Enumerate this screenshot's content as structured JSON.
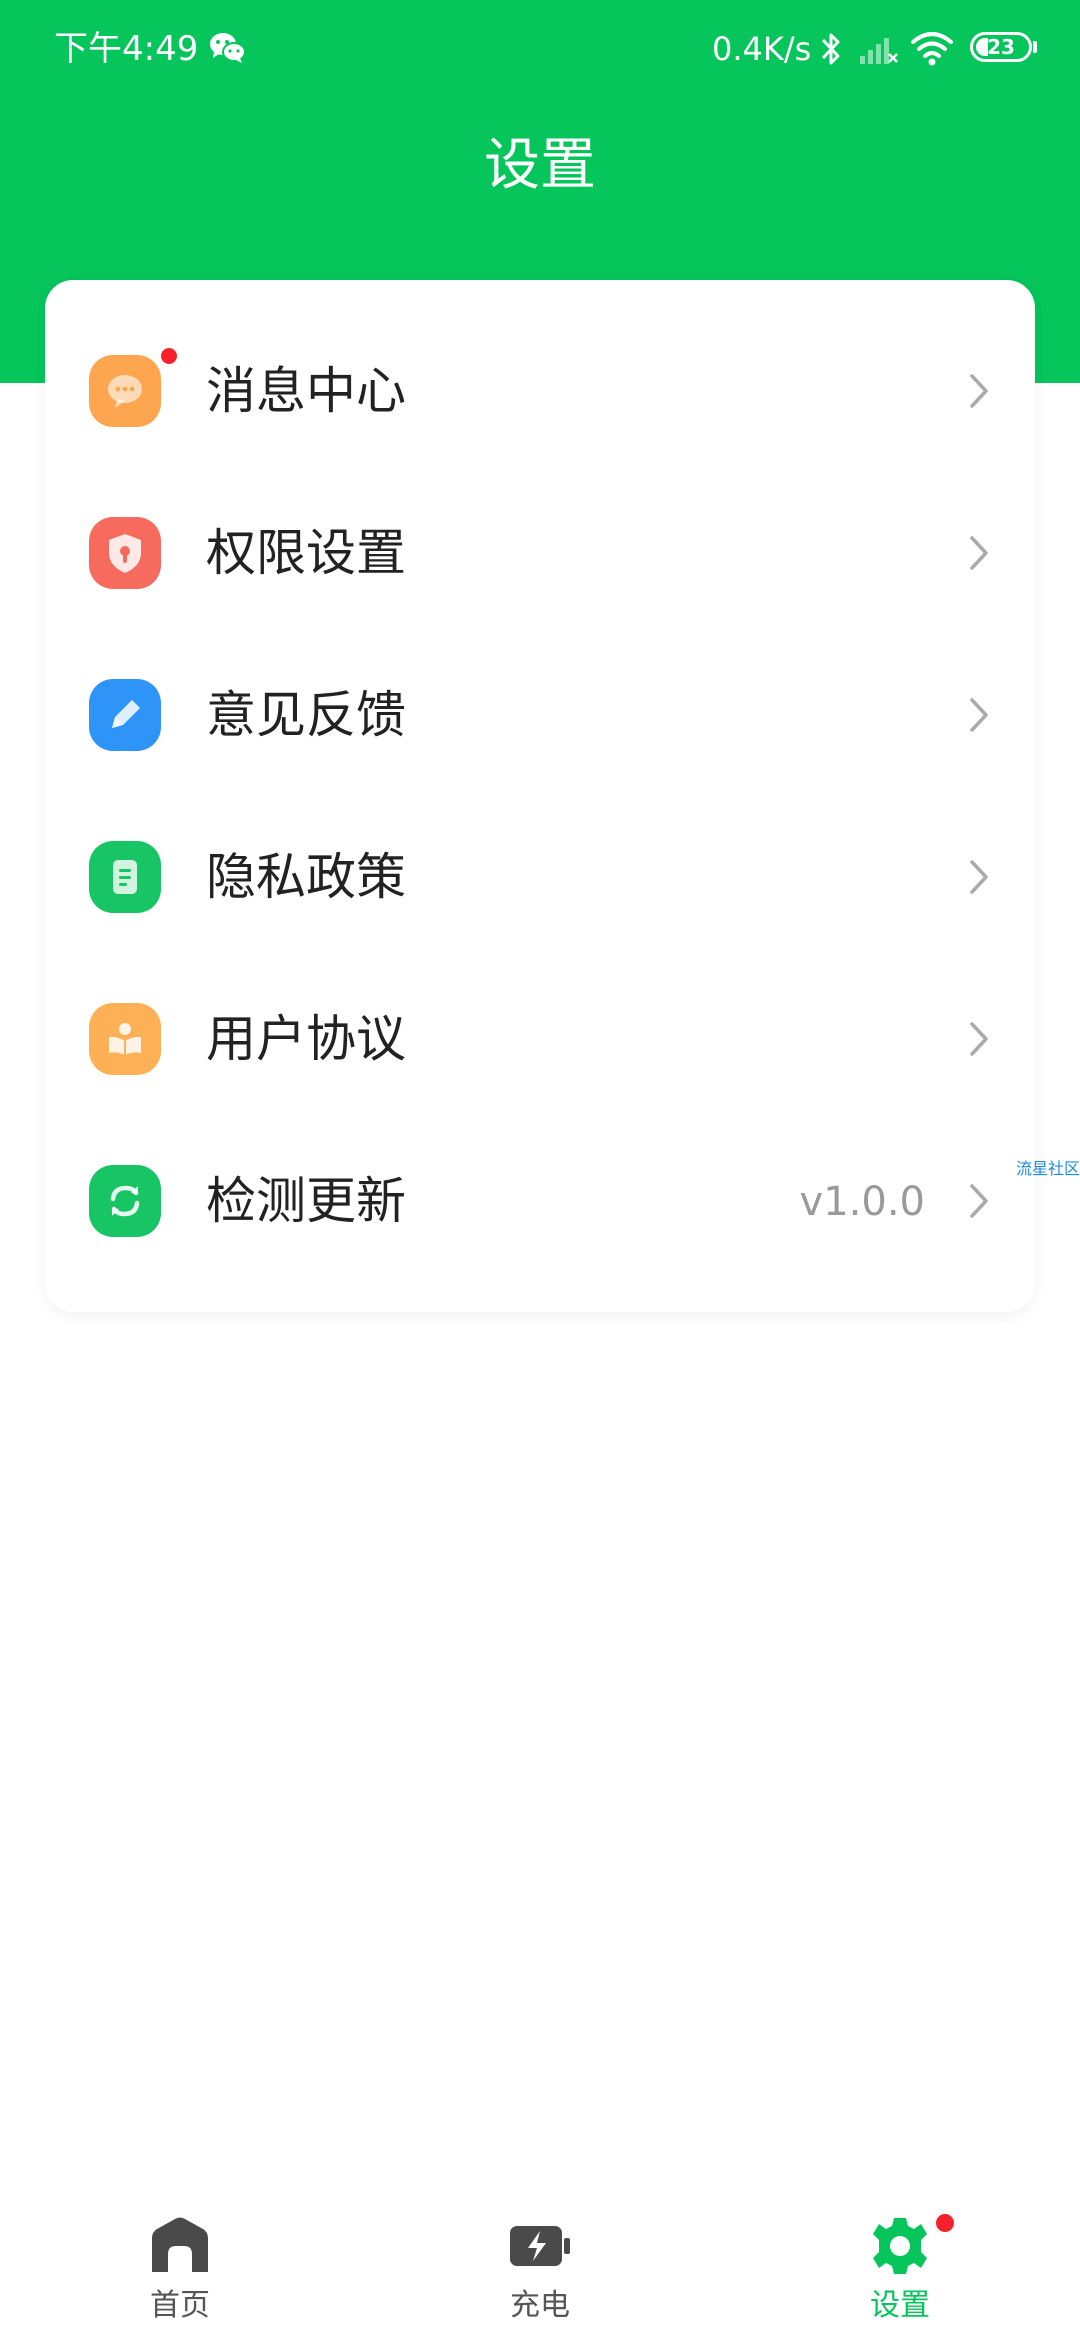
{
  "colors": {
    "brand": "#05c55b",
    "badge": "#f5222d",
    "text": "#222222",
    "muted": "#9a9a9a"
  },
  "status_bar": {
    "time": "下午4:49",
    "net_speed": "0.4K/s",
    "battery": "23",
    "battery_level_percent": 23,
    "icons": [
      "wechat-icon",
      "bluetooth-icon",
      "signal-icon",
      "wifi-icon",
      "battery-icon"
    ]
  },
  "header": {
    "title": "设置"
  },
  "settings": {
    "items": [
      {
        "label": "消息中心",
        "icon": "message-icon",
        "icon_color": "#fda54f",
        "badge": true
      },
      {
        "label": "权限设置",
        "icon": "shield-icon",
        "icon_color": "#f76a5e"
      },
      {
        "label": "意见反馈",
        "icon": "pencil-icon",
        "icon_color": "#2f94f7"
      },
      {
        "label": "隐私政策",
        "icon": "document-icon",
        "icon_color": "#18c564"
      },
      {
        "label": "用户协议",
        "icon": "reader-icon",
        "icon_color": "#fdb055"
      },
      {
        "label": "检测更新",
        "icon": "refresh-icon",
        "icon_color": "#18c564",
        "value": "v1.0.0"
      }
    ]
  },
  "watermark": "流星社区",
  "tab_bar": {
    "tabs": [
      {
        "label": "首页",
        "icon": "home-icon"
      },
      {
        "label": "充电",
        "icon": "battery-charge-icon"
      },
      {
        "label": "设置",
        "icon": "gear-icon",
        "active": true,
        "badge": true
      }
    ]
  }
}
